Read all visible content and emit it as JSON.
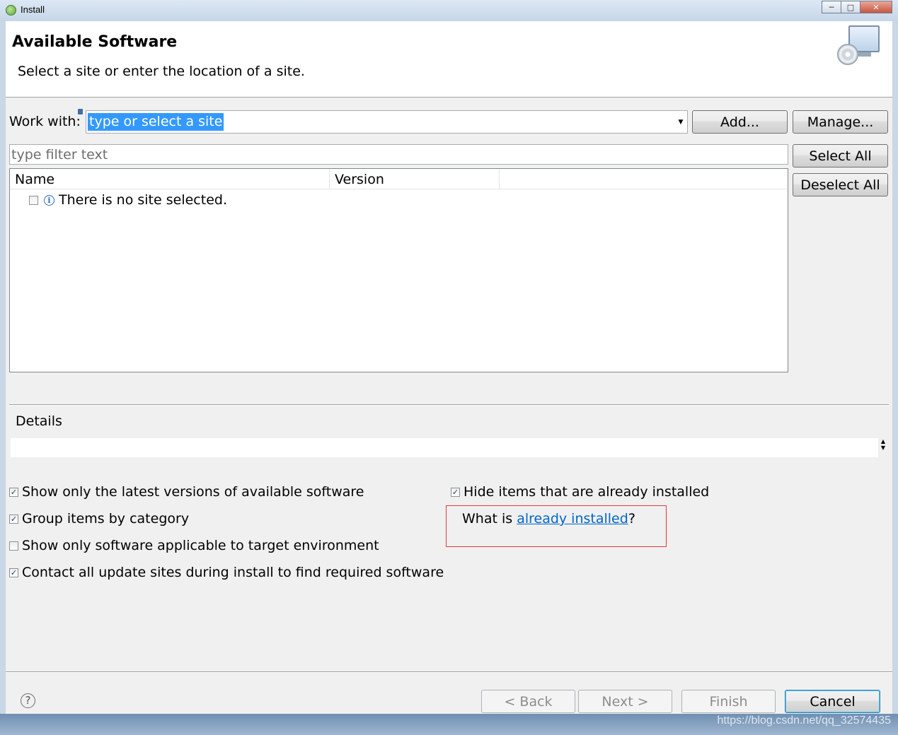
{
  "window": {
    "title": "Install"
  },
  "banner": {
    "title": "Available Software",
    "subtitle": "Select a site or enter the location of a site.",
    "icon": "computer-cd-icon"
  },
  "work_with": {
    "label": "Work with:",
    "value": "type or select a site",
    "add_label": "Add...",
    "manage_label": "Manage..."
  },
  "filter": {
    "placeholder": "type filter text"
  },
  "side_buttons": {
    "select_all": "Select All",
    "deselect_all": "Deselect All"
  },
  "table": {
    "columns": [
      "Name",
      "Version"
    ],
    "rows": [
      {
        "text": "There is no site selected.",
        "checked": false,
        "icon": "info-icon"
      }
    ]
  },
  "details": {
    "label": "Details",
    "value": ""
  },
  "options": {
    "left": [
      {
        "label": "Show only the latest versions of available software",
        "checked": true
      },
      {
        "label": "Group items by category",
        "checked": true
      },
      {
        "label": "Show only software applicable to target environment",
        "checked": false
      },
      {
        "label": "Contact all update sites during install to find required software",
        "checked": true
      }
    ],
    "hide_installed": {
      "label": "Hide items that are already installed",
      "checked": true
    },
    "what_is": {
      "prefix": "What is ",
      "link": "already installed",
      "suffix": "?"
    }
  },
  "nav": {
    "back": "< Back",
    "next": "Next >",
    "finish": "Finish",
    "cancel": "Cancel"
  },
  "watermark": "https://blog.csdn.net/qq_32574435",
  "colors": {
    "selection": "#3399ff",
    "link": "#0066cc",
    "highlight_box": "#e03a3a"
  }
}
